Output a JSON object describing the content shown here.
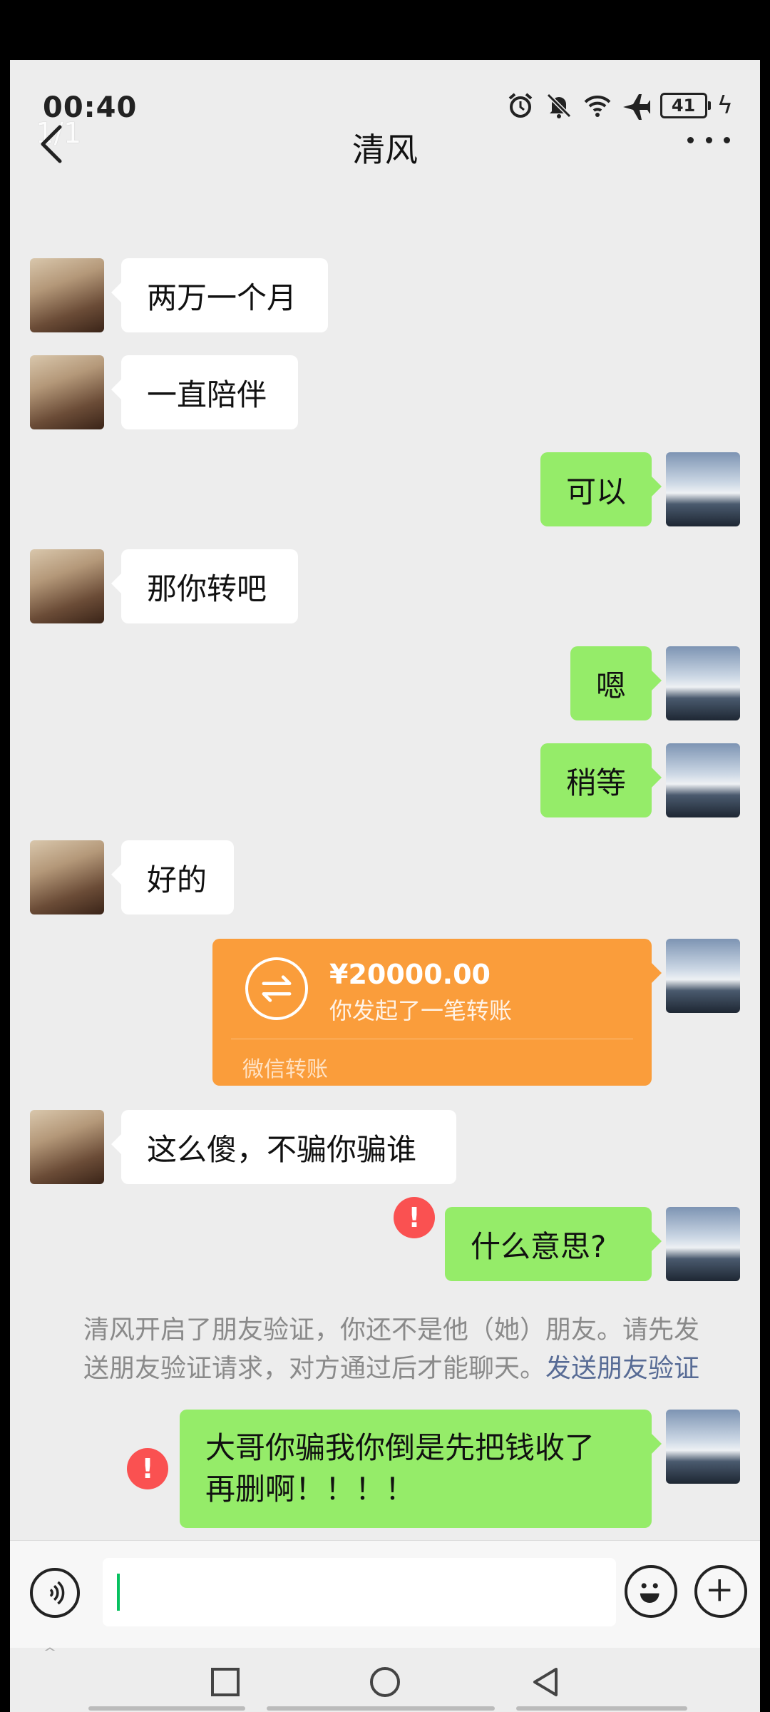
{
  "status_bar": {
    "time": "00:40",
    "page_indicator": "1/1",
    "battery": "41",
    "icons": [
      "alarm-icon",
      "mute-bell-icon",
      "wifi-icon",
      "airplane-icon",
      "battery-icon",
      "charging-icon"
    ]
  },
  "header": {
    "title": "清风",
    "back_icon": "chevron-left-icon",
    "more_icon": "more-dots-icon"
  },
  "messages": [
    {
      "side": "left",
      "text": "两万一个月"
    },
    {
      "side": "left",
      "text": "一直陪伴"
    },
    {
      "side": "right",
      "text": "可以"
    },
    {
      "side": "left",
      "text": "那你转吧"
    },
    {
      "side": "right",
      "text": "嗯"
    },
    {
      "side": "right",
      "text": "稍等"
    },
    {
      "side": "left",
      "text": "好的"
    },
    {
      "side": "right",
      "type": "transfer",
      "amount": "¥20000.00",
      "description": "你发起了一笔转账",
      "label": "微信转账"
    },
    {
      "side": "left",
      "text": "这么傻，不骗你骗谁"
    },
    {
      "side": "right",
      "text": "什么意思?",
      "failed": true
    },
    {
      "side": "right",
      "text_line1": "大哥你骗我你倒是先把钱收了",
      "text_line2": "再删啊！！！！",
      "failed": true
    }
  ],
  "system_notice": {
    "line1": "清风开启了朋友验证，你还不是他（她）朋友。请先发",
    "line2_text": "送朋友验证请求，对方通过后才能聊天。",
    "link": "发送朋友验证"
  },
  "error_mark": "!",
  "input_bar": {
    "placeholder": "",
    "voice_icon": "voice-icon",
    "emoji_icon": "emoji-icon",
    "plus_icon": "plus-icon"
  },
  "colors": {
    "background": "#ededed",
    "bubble_self": "#95ec69",
    "bubble_other": "#ffffff",
    "transfer": "#fa9d3b",
    "error": "#fa5151",
    "link": "#576b95"
  }
}
